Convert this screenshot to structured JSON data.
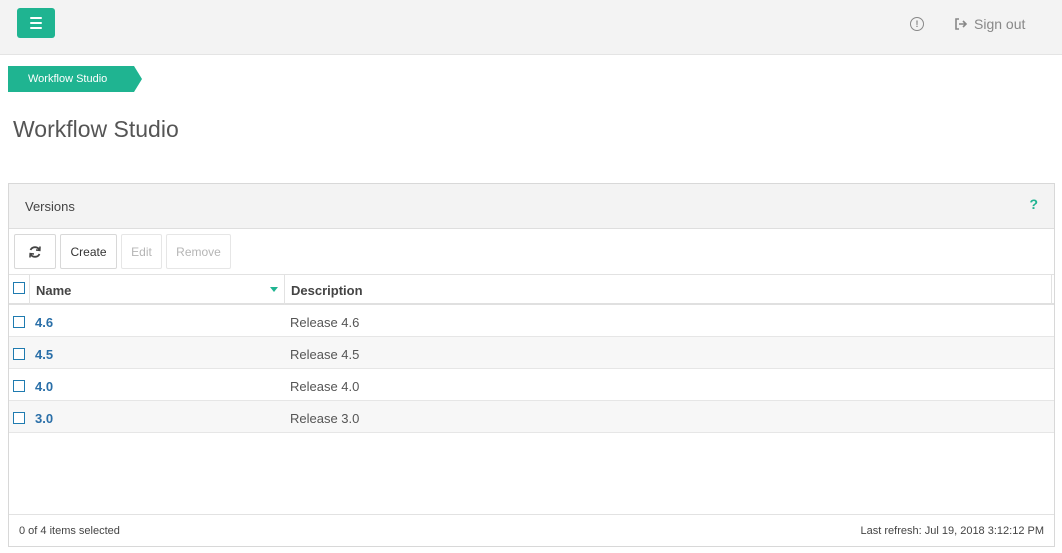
{
  "topbar": {
    "menu_icon": "hamburger-menu-icon",
    "info_icon": "info-circle-icon",
    "info_glyph": "!",
    "signout_label": "Sign out",
    "accent": "#1fb491"
  },
  "breadcrumb": {
    "items": [
      {
        "label": "Workflow Studio"
      }
    ]
  },
  "page": {
    "title": "Workflow Studio"
  },
  "panel": {
    "title": "Versions",
    "help_glyph": "?",
    "toolbar": {
      "refresh_icon": "refresh-icon",
      "create_label": "Create",
      "edit_label": "Edit",
      "remove_label": "Remove"
    },
    "columns": {
      "name": "Name",
      "description": "Description",
      "sort": "descending"
    },
    "rows": [
      {
        "name": "4.6",
        "description": "Release 4.6"
      },
      {
        "name": "4.5",
        "description": "Release 4.5"
      },
      {
        "name": "4.0",
        "description": "Release 4.0"
      },
      {
        "name": "3.0",
        "description": "Release 3.0"
      }
    ],
    "footer": {
      "selection": "0 of 4 items selected",
      "last_refresh": "Last refresh: Jul 19, 2018 3:12:12 PM"
    }
  }
}
